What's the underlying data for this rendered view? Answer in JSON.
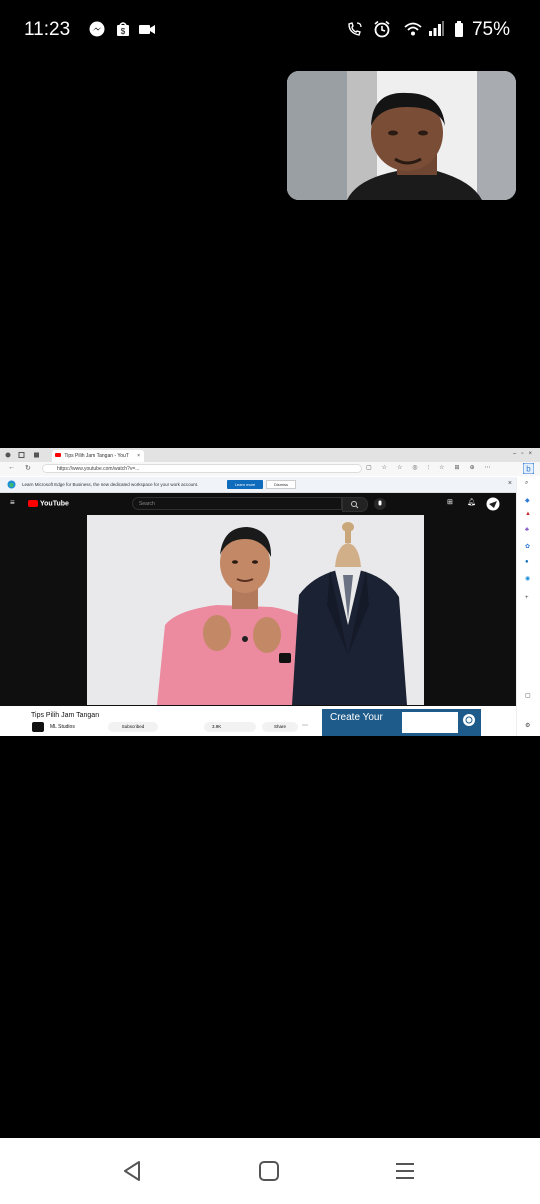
{
  "status_bar": {
    "time": "11:23",
    "battery": "75%"
  },
  "browser": {
    "tab_title": "Tips Pilih Jam Tangan - YouT",
    "url": "https://www.youtube.com/watch?v=...",
    "infobar_text": "Learn Microsoft Edge for Business, the new dedicated workspace for your work account.",
    "learn_more_label": "Learn more",
    "dismiss_label": "Dismiss"
  },
  "youtube": {
    "logo_text": "YouTube",
    "search_placeholder": "Search",
    "video_title": "Tips Pilih Jam Tangan",
    "channel_name": "ML Studios",
    "subscribed_label": "Subscribed",
    "likes": "3.9K",
    "share_label": "Share",
    "ad_text": "Create Your"
  },
  "colors": {
    "youtube_red": "#ff0000",
    "edge_blue": "#0f6cbd",
    "ad_blue": "#1f5b8a"
  }
}
